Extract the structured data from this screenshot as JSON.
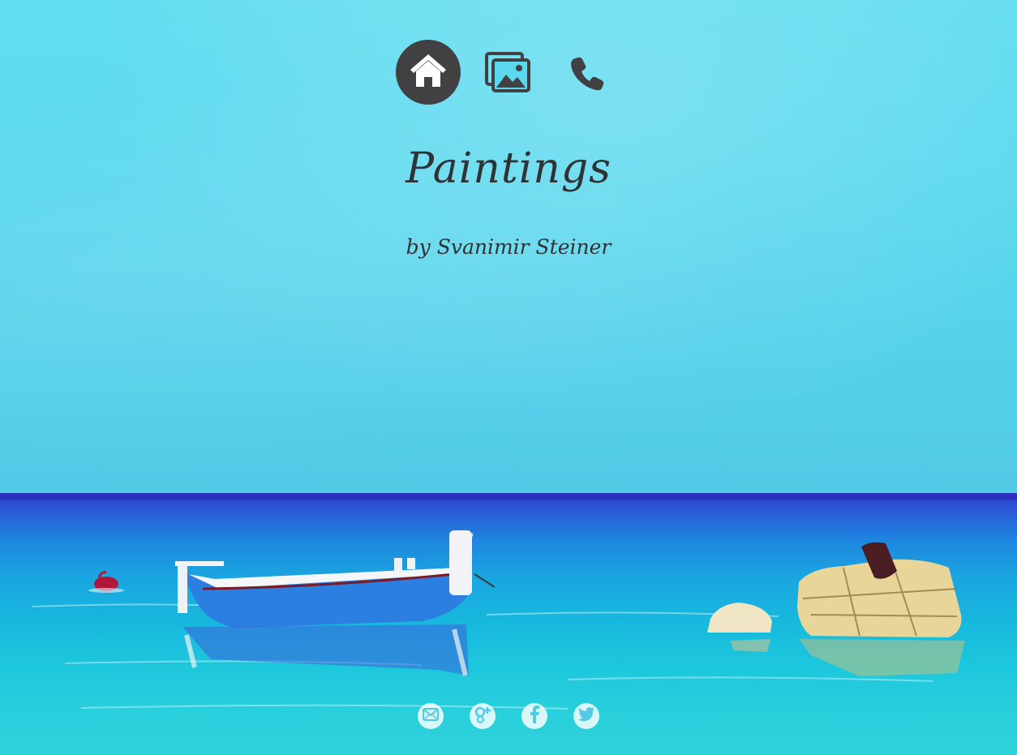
{
  "nav": {
    "items": [
      {
        "icon": "home-icon",
        "active": true
      },
      {
        "icon": "gallery-icon",
        "active": false
      },
      {
        "icon": "phone-icon",
        "active": false
      }
    ]
  },
  "header": {
    "title": "Paintings",
    "subtitle": "by Svanimir Steiner"
  },
  "social": {
    "items": [
      {
        "icon": "mail-icon"
      },
      {
        "icon": "google-plus-icon"
      },
      {
        "icon": "facebook-icon"
      },
      {
        "icon": "twitter-icon"
      }
    ]
  },
  "colors": {
    "icon_dark": "#414143",
    "text": "#2f3336",
    "sky": "#5bd8ee",
    "sea_deep": "#2e38c8",
    "sea_shallow": "#2fd2da"
  }
}
